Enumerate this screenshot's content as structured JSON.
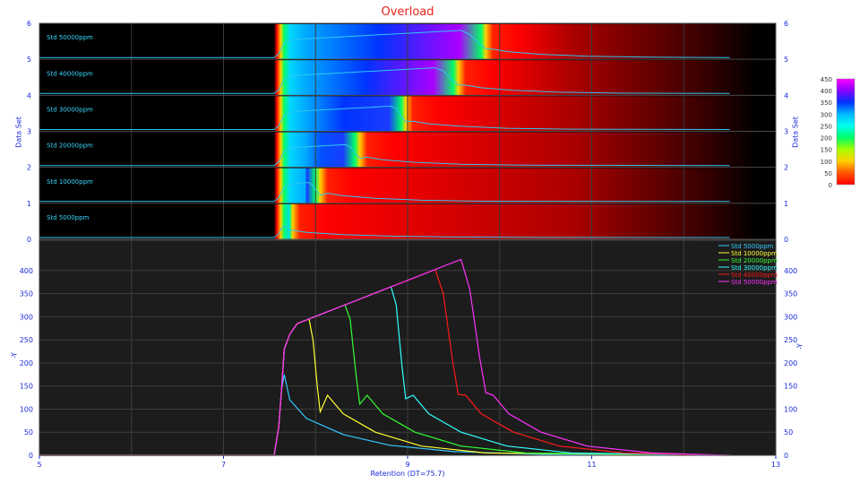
{
  "chart_data": {
    "title": "Overload",
    "top_panel": {
      "type": "heatmap",
      "ylabel_left": "Data Set",
      "ylabel_right": "Data Set",
      "ylim": [
        0,
        6
      ],
      "yticks": [
        "0",
        "1",
        "2",
        "3",
        "4",
        "5",
        "6"
      ],
      "series_labels": [
        "Std 5000ppm",
        "Std 10000ppm",
        "Std 20000ppm",
        "Std 30000ppm",
        "Std 40000ppm",
        "Std 50000ppm"
      ],
      "colorbar": {
        "ticks": [
          "450",
          "400",
          "350",
          "300",
          "250",
          "200",
          "150",
          "100",
          "50",
          "0"
        ],
        "range": [
          0,
          450
        ],
        "stops": [
          "#ff00ff",
          "#9900ff",
          "#0033ff",
          "#00ccff",
          "#00ff66",
          "#33ff00",
          "#ccff00",
          "#ffd700",
          "#ff6600",
          "#ff0000"
        ]
      }
    },
    "bottom_panel": {
      "type": "line",
      "xlabel": "Retention  (DT=75.7)",
      "ylabel_left": "-Y",
      "ylabel_right": "-Y",
      "xlim": [
        5,
        13
      ],
      "ylim": [
        0,
        450
      ],
      "xticks": [
        "5",
        "7",
        "9",
        "11",
        "13"
      ],
      "yticks": [
        "0",
        "50",
        "100",
        "150",
        "200",
        "250",
        "300",
        "350",
        "400"
      ],
      "legend_position": "top-right",
      "series": [
        {
          "name": "Std 5000ppm",
          "color": "#33c8ff",
          "peak_x": 7.65,
          "peak_y": 175,
          "end_x": 7.75
        },
        {
          "name": "Std 10000ppm",
          "color": "#ffff33",
          "peak_x": 7.93,
          "peak_y": 294,
          "end_x": 8.05
        },
        {
          "name": "Std 20000ppm",
          "color": "#33ff33",
          "peak_x": 8.32,
          "peak_y": 346,
          "end_x": 8.48
        },
        {
          "name": "Std 30000ppm",
          "color": "#33ffff",
          "peak_x": 8.82,
          "peak_y": 383,
          "end_x": 8.98
        },
        {
          "name": "Std 40000ppm",
          "color": "#ff1a1a",
          "peak_x": 9.3,
          "peak_y": 412,
          "end_x": 9.55
        },
        {
          "name": "Std 50000ppm",
          "color": "#ff33ff",
          "peak_x": 9.58,
          "peak_y": 424,
          "end_x": 9.85
        }
      ]
    }
  }
}
